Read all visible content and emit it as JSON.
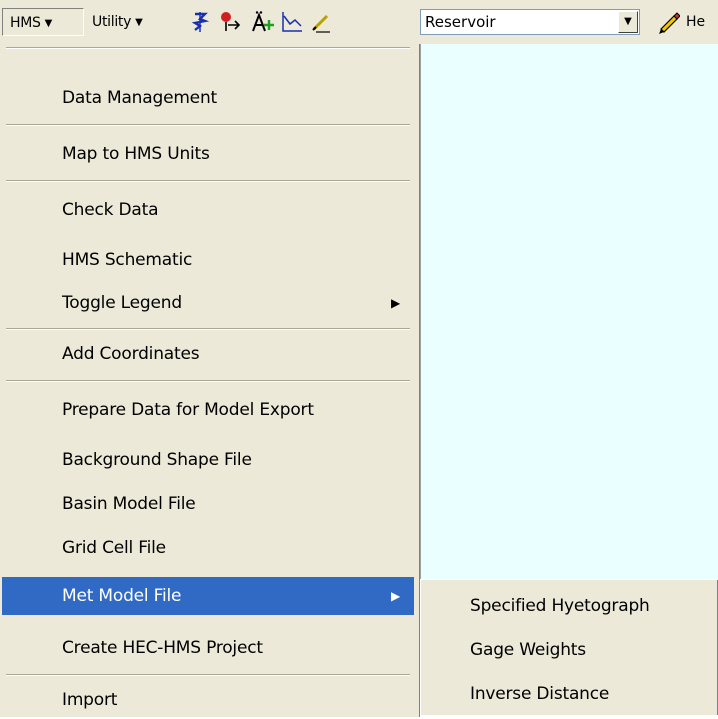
{
  "toolbar": {
    "hms_menu": "HMS",
    "utility_menu": "Utility",
    "dropdown_arrow_glyph": "▼",
    "combo_value": "Reservoir",
    "truncated_label": "He",
    "icons": [
      "network-tool-icon",
      "point-tool-icon",
      "add-label-icon",
      "profile-graph-icon",
      "edit-pen-icon",
      "pencil-icon"
    ]
  },
  "menu": {
    "items": [
      {
        "label": "Data Management"
      },
      {
        "label": "Map to HMS Units"
      },
      {
        "label": "Check Data"
      },
      {
        "label": "HMS Schematic"
      },
      {
        "label": "Toggle Legend",
        "submenu": true
      },
      {
        "label": "Add Coordinates"
      },
      {
        "label": "Prepare Data for Model Export"
      },
      {
        "label": "Background Shape File"
      },
      {
        "label": "Basin Model File"
      },
      {
        "label": "Grid Cell File"
      },
      {
        "label": "Met Model File",
        "submenu": true,
        "selected": true
      },
      {
        "label": "Create HEC-HMS Project"
      },
      {
        "label": "Import"
      }
    ],
    "submenu_arrow_glyph": "▶"
  },
  "submenu": {
    "items": [
      {
        "label": "Specified Hyetograph"
      },
      {
        "label": "Gage Weights"
      },
      {
        "label": "Inverse Distance"
      }
    ]
  },
  "colors": {
    "menu_bg": "#ece9d8",
    "highlight": "#316ac5",
    "map_bg": "#eaffff"
  }
}
